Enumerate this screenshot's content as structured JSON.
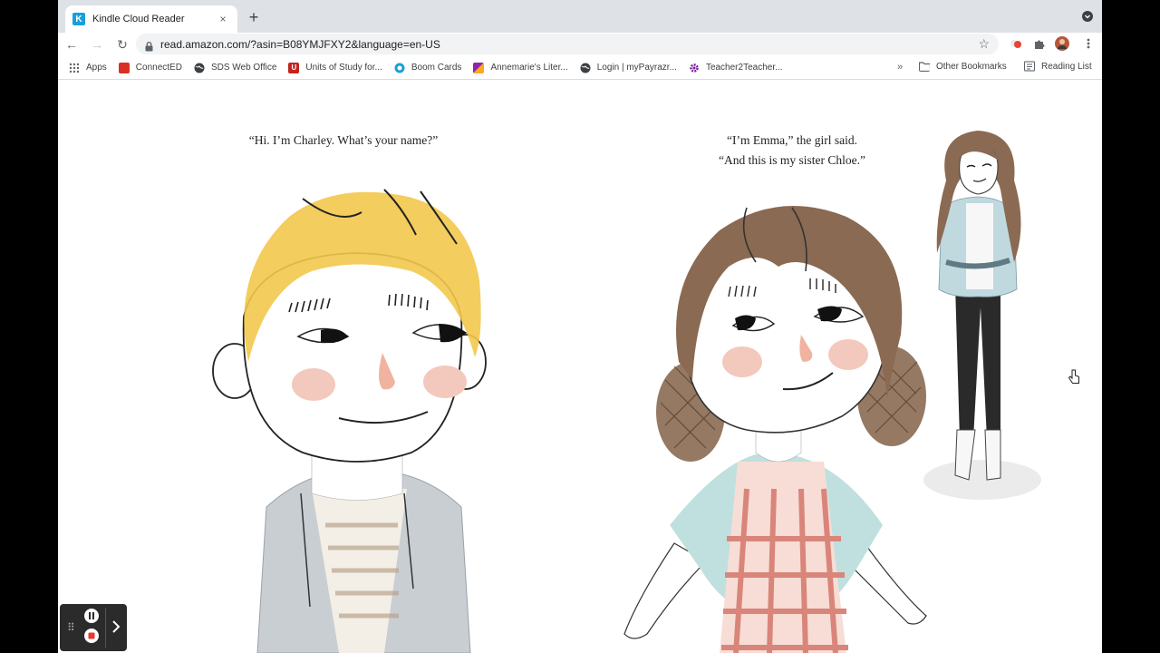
{
  "browser": {
    "tab_title": "Kindle Cloud Reader",
    "tab_favicon_letter": "K",
    "tab_close": "×",
    "new_tab": "+",
    "url": "read.amazon.com/?asin=B08YMJFXY2&language=en-US",
    "nav": {
      "back": "←",
      "forward": "→",
      "reload": "↻"
    },
    "star": "☆"
  },
  "bookmarks": {
    "items": [
      {
        "label": "Apps",
        "icon": "apps-grid-icon",
        "color": "#5f6368"
      },
      {
        "label": "ConnectED",
        "icon": "connected-icon",
        "color": "#d93025"
      },
      {
        "label": "SDS Web Office",
        "icon": "globe-icon",
        "color": "#3c4043"
      },
      {
        "label": "Units of Study for...",
        "icon": "units-icon",
        "color": "#c5221f"
      },
      {
        "label": "Boom Cards",
        "icon": "boom-icon",
        "color": "#1a9fda"
      },
      {
        "label": "Annemarie's Liter...",
        "icon": "annemarie-icon",
        "color": "#8e24aa"
      },
      {
        "label": "Login | myPayrazr...",
        "icon": "globe-icon",
        "color": "#3c4043"
      },
      {
        "label": "Teacher2Teacher...",
        "icon": "gear-icon",
        "color": "#7b1fa2"
      }
    ],
    "more": "»",
    "other": "Other Bookmarks",
    "reading_list": "Reading List"
  },
  "page": {
    "caption_left": "“Hi. I’m Charley. What’s your name?”",
    "caption_right_line1": "“I’m Emma,” the girl said.",
    "caption_right_line2": "“And this is my sister Chloe.”"
  },
  "colors": {
    "tabstrip": "#dee1e6",
    "kindle_blue": "#1a9fda",
    "hair_blond": "#f2c84b",
    "hair_brown": "#8a6a52",
    "shirt_teal": "#bfe0df",
    "apron_red": "#d9857a",
    "cheek": "#f3c8bd",
    "jacket_gray": "#c9ced3"
  }
}
